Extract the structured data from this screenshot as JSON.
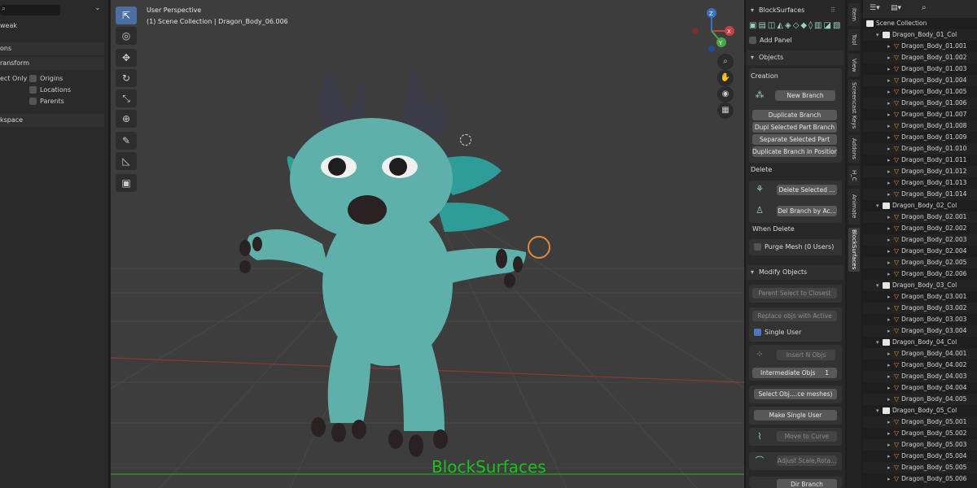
{
  "left_panel": {
    "row1": "weak",
    "section_options": "ons",
    "section_transform": "ransform",
    "affect_only": "ect Only",
    "cb_origins": "Origins",
    "cb_locations": "Locations",
    "cb_parents": "Parents",
    "section_workspace": "kspace"
  },
  "viewport": {
    "title": "User Perspective",
    "subtitle": "(1) Scene Collection | Dragon_Body_06.006",
    "watermark": "BlockSurfaces",
    "gizmo": {
      "x": "X",
      "y": "Y",
      "z": "Z"
    }
  },
  "npanel": {
    "title": "BlockSurfaces",
    "add_panel": "Add Panel",
    "objects_header": "Objects",
    "creation_label": "Creation",
    "new_branch": "New Branch",
    "duplicate_branch": "Duplicate Branch",
    "dupl_selected": "Dupl Selected Part Branch",
    "separate_selected": "Separate Selected Part",
    "duplicate_in_position": "Duplicate Branch in Position",
    "delete_label": "Delete",
    "delete_selected": "Delete Selected ...",
    "del_branch": "Del Branch by Ac...",
    "when_delete": "When Delete",
    "purge_mesh": "Purge Mesh (0 Users)",
    "modify_header": "Modify Objects",
    "parent_select": "Parent Select to Closest",
    "replace_objs": "Replace objs with Active",
    "single_user": "Single User",
    "insert_n": "Insert N Objs",
    "intermediate_objs": "Intermediate Objs",
    "intermediate_value": "1",
    "select_obj": "Select Obj....ce meshes)",
    "make_single_user": "Make Single User",
    "move_to_curve": "Move to Curve",
    "adjust_scale": "Adjust Scale,Rota...",
    "dir_branch": "Dir Branch"
  },
  "vtabs": [
    "Item",
    "Tool",
    "View",
    "Screencast Keys",
    "Addons",
    "H_C",
    "Animate",
    "BlockSurfaces"
  ],
  "outliner": {
    "scene_collection": "Scene Collection",
    "collections": [
      {
        "name": "Dragon_Body_01_Col",
        "items": [
          "Dragon_Body_01.001",
          "Dragon_Body_01.002",
          "Dragon_Body_01.003",
          "Dragon_Body_01.004",
          "Dragon_Body_01.005",
          "Dragon_Body_01.006",
          "Dragon_Body_01.007",
          "Dragon_Body_01.008",
          "Dragon_Body_01.009",
          "Dragon_Body_01.010",
          "Dragon_Body_01.011",
          "Dragon_Body_01.012",
          "Dragon_Body_01.013",
          "Dragon_Body_01.014"
        ]
      },
      {
        "name": "Dragon_Body_02_Col",
        "items": [
          "Dragon_Body_02.001",
          "Dragon_Body_02.002",
          "Dragon_Body_02.003",
          "Dragon_Body_02.004",
          "Dragon_Body_02.005",
          "Dragon_Body_02.006"
        ]
      },
      {
        "name": "Dragon_Body_03_Col",
        "items": [
          "Dragon_Body_03.001",
          "Dragon_Body_03.002",
          "Dragon_Body_03.003",
          "Dragon_Body_03.004"
        ]
      },
      {
        "name": "Dragon_Body_04_Col",
        "items": [
          "Dragon_Body_04.001",
          "Dragon_Body_04.002",
          "Dragon_Body_04.003",
          "Dragon_Body_04.004",
          "Dragon_Body_04.005"
        ]
      },
      {
        "name": "Dragon_Body_05_Col",
        "items": [
          "Dragon_Body_05.001",
          "Dragon_Body_05.002",
          "Dragon_Body_05.003",
          "Dragon_Body_05.004",
          "Dragon_Body_05.005",
          "Dragon_Body_05.006"
        ]
      }
    ]
  },
  "colors": {
    "body": "#5fb0aa",
    "horn": "#3c3c48",
    "wing": "#2e9c97",
    "claw": "#2a2222",
    "watermark": "#19c319",
    "active_tool": "#4a6fa0"
  }
}
